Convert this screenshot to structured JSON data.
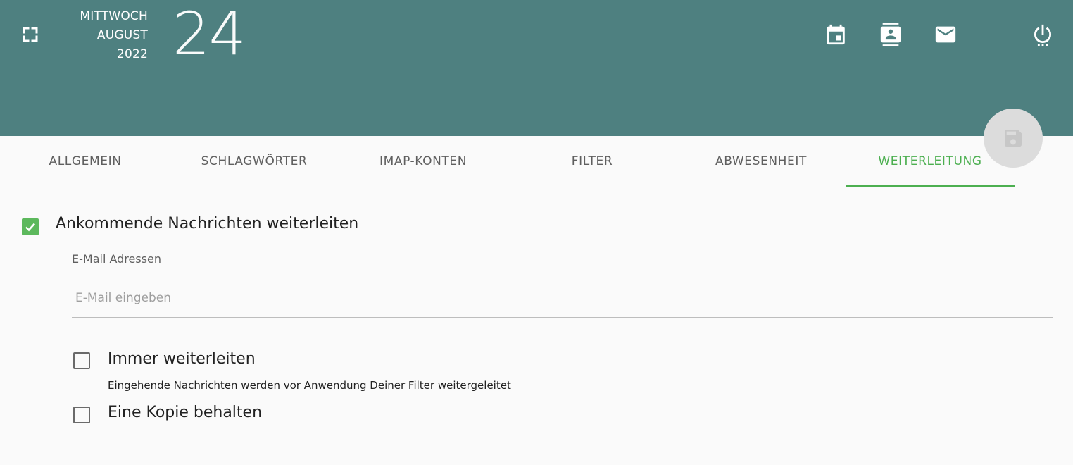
{
  "header": {
    "weekday": "MITTWOCH",
    "month": "AUGUST",
    "year": "2022",
    "day": "24",
    "colors": {
      "header_bg": "#4e8080",
      "accent": "#4caf50"
    },
    "icons": [
      "fullscreen-icon",
      "calendar-icon",
      "contacts-icon",
      "mail-icon",
      "power-icon"
    ]
  },
  "save_button": {
    "icon": "save-icon"
  },
  "tabs": [
    {
      "label": "ALLGEMEIN",
      "active": false
    },
    {
      "label": "SCHLAGWÖRTER",
      "active": false
    },
    {
      "label": "IMAP-KONTEN",
      "active": false
    },
    {
      "label": "FILTER",
      "active": false
    },
    {
      "label": "ABWESENHEIT",
      "active": false
    },
    {
      "label": "WEITERLEITUNG",
      "active": true
    }
  ],
  "forwarding": {
    "enable_label": "Ankommende Nachrichten weiterleiten",
    "enable_checked": true,
    "email_label": "E-Mail Adressen",
    "email_placeholder": "E-Mail eingeben",
    "email_value": "",
    "always_label": "Immer weiterleiten",
    "always_checked": false,
    "always_description": "Eingehende Nachrichten werden vor Anwendung Deiner Filter weitergeleitet",
    "keep_copy_label": "Eine Kopie behalten",
    "keep_copy_checked": false
  }
}
